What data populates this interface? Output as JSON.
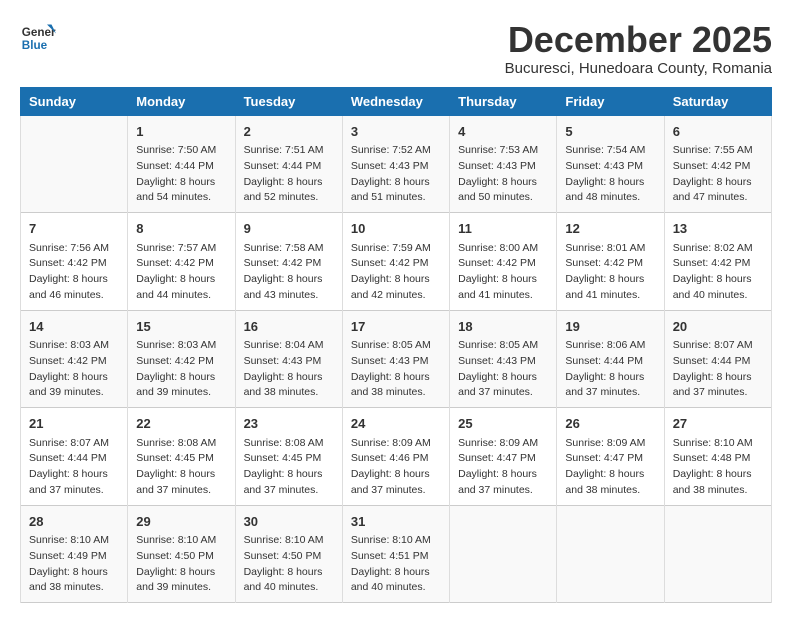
{
  "header": {
    "logo_general": "General",
    "logo_blue": "Blue",
    "month_title": "December 2025",
    "subtitle": "Bucuresci, Hunedoara County, Romania"
  },
  "weekdays": [
    "Sunday",
    "Monday",
    "Tuesday",
    "Wednesday",
    "Thursday",
    "Friday",
    "Saturday"
  ],
  "weeks": [
    [
      {
        "day": "",
        "info": ""
      },
      {
        "day": "1",
        "info": "Sunrise: 7:50 AM\nSunset: 4:44 PM\nDaylight: 8 hours\nand 54 minutes."
      },
      {
        "day": "2",
        "info": "Sunrise: 7:51 AM\nSunset: 4:44 PM\nDaylight: 8 hours\nand 52 minutes."
      },
      {
        "day": "3",
        "info": "Sunrise: 7:52 AM\nSunset: 4:43 PM\nDaylight: 8 hours\nand 51 minutes."
      },
      {
        "day": "4",
        "info": "Sunrise: 7:53 AM\nSunset: 4:43 PM\nDaylight: 8 hours\nand 50 minutes."
      },
      {
        "day": "5",
        "info": "Sunrise: 7:54 AM\nSunset: 4:43 PM\nDaylight: 8 hours\nand 48 minutes."
      },
      {
        "day": "6",
        "info": "Sunrise: 7:55 AM\nSunset: 4:42 PM\nDaylight: 8 hours\nand 47 minutes."
      }
    ],
    [
      {
        "day": "7",
        "info": "Sunrise: 7:56 AM\nSunset: 4:42 PM\nDaylight: 8 hours\nand 46 minutes."
      },
      {
        "day": "8",
        "info": "Sunrise: 7:57 AM\nSunset: 4:42 PM\nDaylight: 8 hours\nand 44 minutes."
      },
      {
        "day": "9",
        "info": "Sunrise: 7:58 AM\nSunset: 4:42 PM\nDaylight: 8 hours\nand 43 minutes."
      },
      {
        "day": "10",
        "info": "Sunrise: 7:59 AM\nSunset: 4:42 PM\nDaylight: 8 hours\nand 42 minutes."
      },
      {
        "day": "11",
        "info": "Sunrise: 8:00 AM\nSunset: 4:42 PM\nDaylight: 8 hours\nand 41 minutes."
      },
      {
        "day": "12",
        "info": "Sunrise: 8:01 AM\nSunset: 4:42 PM\nDaylight: 8 hours\nand 41 minutes."
      },
      {
        "day": "13",
        "info": "Sunrise: 8:02 AM\nSunset: 4:42 PM\nDaylight: 8 hours\nand 40 minutes."
      }
    ],
    [
      {
        "day": "14",
        "info": "Sunrise: 8:03 AM\nSunset: 4:42 PM\nDaylight: 8 hours\nand 39 minutes."
      },
      {
        "day": "15",
        "info": "Sunrise: 8:03 AM\nSunset: 4:42 PM\nDaylight: 8 hours\nand 39 minutes."
      },
      {
        "day": "16",
        "info": "Sunrise: 8:04 AM\nSunset: 4:43 PM\nDaylight: 8 hours\nand 38 minutes."
      },
      {
        "day": "17",
        "info": "Sunrise: 8:05 AM\nSunset: 4:43 PM\nDaylight: 8 hours\nand 38 minutes."
      },
      {
        "day": "18",
        "info": "Sunrise: 8:05 AM\nSunset: 4:43 PM\nDaylight: 8 hours\nand 37 minutes."
      },
      {
        "day": "19",
        "info": "Sunrise: 8:06 AM\nSunset: 4:44 PM\nDaylight: 8 hours\nand 37 minutes."
      },
      {
        "day": "20",
        "info": "Sunrise: 8:07 AM\nSunset: 4:44 PM\nDaylight: 8 hours\nand 37 minutes."
      }
    ],
    [
      {
        "day": "21",
        "info": "Sunrise: 8:07 AM\nSunset: 4:44 PM\nDaylight: 8 hours\nand 37 minutes."
      },
      {
        "day": "22",
        "info": "Sunrise: 8:08 AM\nSunset: 4:45 PM\nDaylight: 8 hours\nand 37 minutes."
      },
      {
        "day": "23",
        "info": "Sunrise: 8:08 AM\nSunset: 4:45 PM\nDaylight: 8 hours\nand 37 minutes."
      },
      {
        "day": "24",
        "info": "Sunrise: 8:09 AM\nSunset: 4:46 PM\nDaylight: 8 hours\nand 37 minutes."
      },
      {
        "day": "25",
        "info": "Sunrise: 8:09 AM\nSunset: 4:47 PM\nDaylight: 8 hours\nand 37 minutes."
      },
      {
        "day": "26",
        "info": "Sunrise: 8:09 AM\nSunset: 4:47 PM\nDaylight: 8 hours\nand 38 minutes."
      },
      {
        "day": "27",
        "info": "Sunrise: 8:10 AM\nSunset: 4:48 PM\nDaylight: 8 hours\nand 38 minutes."
      }
    ],
    [
      {
        "day": "28",
        "info": "Sunrise: 8:10 AM\nSunset: 4:49 PM\nDaylight: 8 hours\nand 38 minutes."
      },
      {
        "day": "29",
        "info": "Sunrise: 8:10 AM\nSunset: 4:50 PM\nDaylight: 8 hours\nand 39 minutes."
      },
      {
        "day": "30",
        "info": "Sunrise: 8:10 AM\nSunset: 4:50 PM\nDaylight: 8 hours\nand 40 minutes."
      },
      {
        "day": "31",
        "info": "Sunrise: 8:10 AM\nSunset: 4:51 PM\nDaylight: 8 hours\nand 40 minutes."
      },
      {
        "day": "",
        "info": ""
      },
      {
        "day": "",
        "info": ""
      },
      {
        "day": "",
        "info": ""
      }
    ]
  ]
}
